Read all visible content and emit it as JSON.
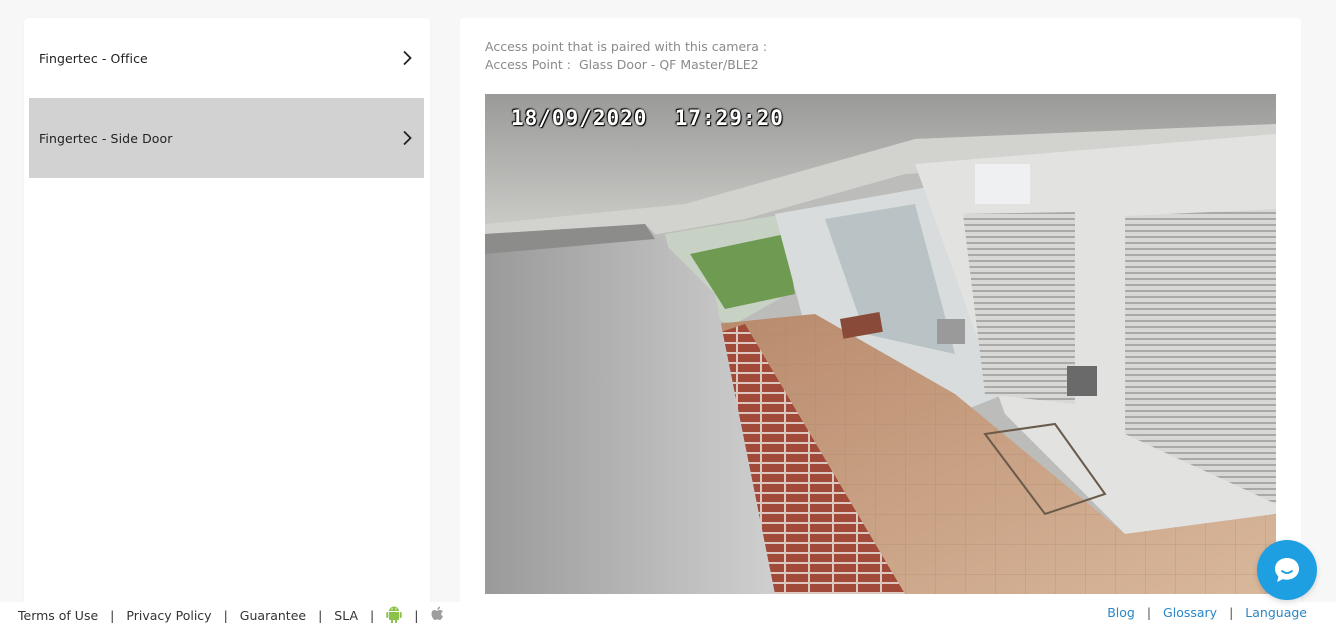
{
  "cameras": [
    {
      "label": "Fingertec - Office",
      "selected": false
    },
    {
      "label": "Fingertec - Side Door",
      "selected": true
    }
  ],
  "info": {
    "paired_text": "Access point that is paired with this camera :",
    "access_point_label": "Access Point :",
    "access_point_value": "Glass Door - QF Master/BLE2"
  },
  "feed": {
    "timestamp": "18/09/2020  17:29:20"
  },
  "footer": {
    "left_links": [
      "Terms of Use",
      "Privacy Policy",
      "Guarantee",
      "SLA"
    ],
    "right_links": [
      "Blog",
      "Glossary",
      "Language"
    ],
    "separator": "|",
    "icons": [
      "android-icon",
      "apple-icon"
    ]
  },
  "colors": {
    "selected_item": "#d2d2d2",
    "link": "#2a86c6",
    "chat": "#1d9fe2",
    "android": "#8bc34a",
    "apple": "#9e9e9e"
  }
}
